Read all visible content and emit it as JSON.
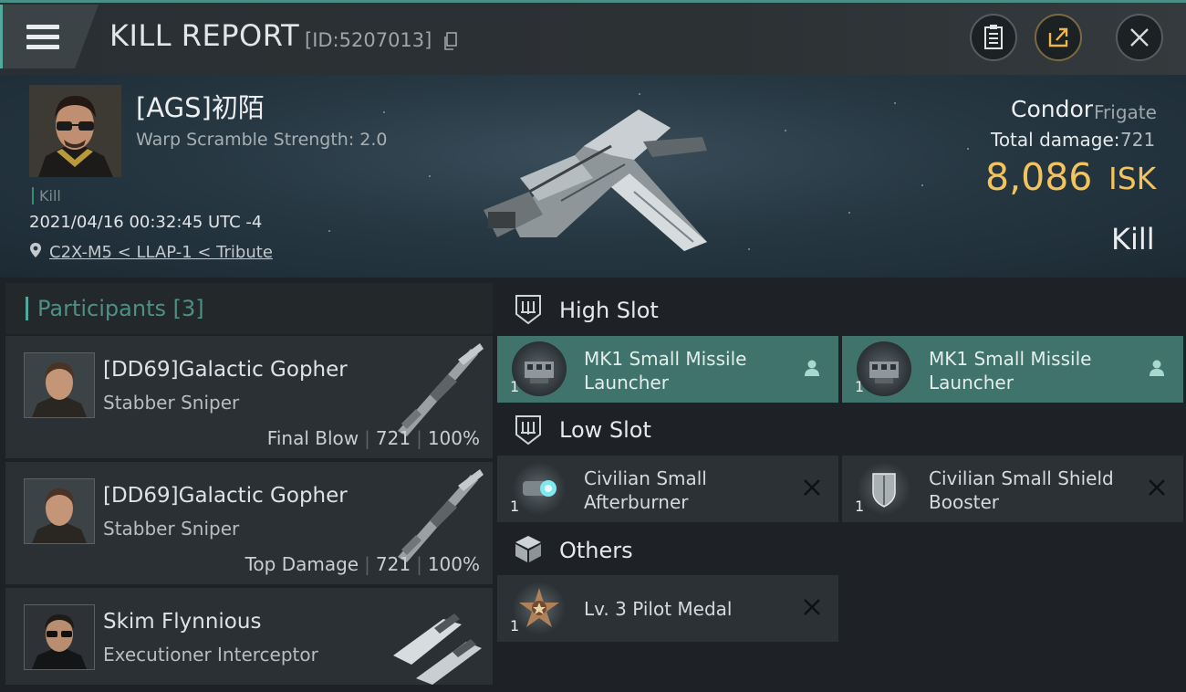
{
  "header": {
    "title": "KILL REPORT",
    "report_id": "[ID:5207013]",
    "icons": [
      "menu-icon",
      "copy-icon",
      "clipboard-icon",
      "share-icon",
      "close-icon"
    ]
  },
  "victim": {
    "name": "[AGS]初陌",
    "scramble": "Warp Scramble Strength: 2.0",
    "tag": "Kill",
    "datetime": "2021/04/16 00:32:45 UTC -4",
    "location": "C2X-M5 < LLAP-1 < Tribute"
  },
  "ship": {
    "name": "Condor",
    "class": "Frigate",
    "damage_label": "Total damage:",
    "damage_value": "721",
    "isk_value": "8,086",
    "isk_unit": "ISK",
    "result": "Kill"
  },
  "participants": {
    "title": "Participants [3]",
    "items": [
      {
        "name": "[DD69]Galactic Gopher",
        "ship": "Stabber Sniper",
        "role": "Final Blow",
        "damage": "721",
        "percent": "100%"
      },
      {
        "name": "[DD69]Galactic Gopher",
        "ship": "Stabber Sniper",
        "role": "Top Damage",
        "damage": "721",
        "percent": "100%"
      },
      {
        "name": "Skim Flynnious",
        "ship": "Executioner Interceptor"
      }
    ]
  },
  "fitting": {
    "high_slot": {
      "title": "High Slot",
      "modules": [
        {
          "name": "MK1 Small Missile Launcher",
          "qty": "1",
          "status": "dropped"
        },
        {
          "name": "MK1 Small Missile Launcher",
          "qty": "1",
          "status": "dropped"
        }
      ]
    },
    "low_slot": {
      "title": "Low Slot",
      "modules": [
        {
          "name": "Civilian Small Afterburner",
          "qty": "1",
          "status": "destroyed"
        },
        {
          "name": "Civilian Small Shield Booster",
          "qty": "1",
          "status": "destroyed"
        }
      ]
    },
    "others": {
      "title": "Others",
      "modules": [
        {
          "name": "Lv. 3 Pilot Medal",
          "qty": "1",
          "status": "destroyed"
        }
      ]
    }
  },
  "colors": {
    "accent": "#52a89b",
    "isk": "#f3c35d",
    "active_module": "#3f736b"
  }
}
